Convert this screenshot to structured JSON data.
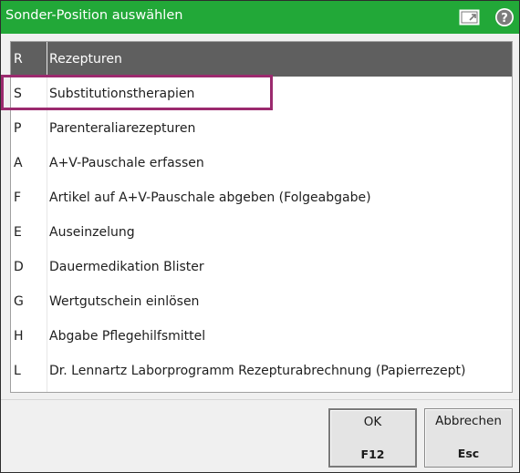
{
  "window": {
    "title": "Sonder-Position auswählen",
    "accent_color": "#22a838",
    "icons": [
      "window-switch-icon",
      "help-icon"
    ]
  },
  "list": {
    "header": {
      "key": "R",
      "label": "Rezepturen"
    },
    "items": [
      {
        "key": "S",
        "label": "Substitutionstherapien",
        "highlighted": true
      },
      {
        "key": "P",
        "label": "Parenteraliarezepturen"
      },
      {
        "key": "A",
        "label": "A+V-Pauschale erfassen"
      },
      {
        "key": "F",
        "label": "Artikel auf A+V-Pauschale abgeben (Folgeabgabe)"
      },
      {
        "key": "E",
        "label": "Auseinzelung"
      },
      {
        "key": "D",
        "label": "Dauermedikation Blister"
      },
      {
        "key": "G",
        "label": "Wertgutschein einlösen"
      },
      {
        "key": "H",
        "label": "Abgabe Pflegehilfsmittel"
      },
      {
        "key": "L",
        "label": "Dr. Lennartz Laborprogramm Rezepturabrechnung (Papierrezept)"
      }
    ],
    "highlight_color": "#9b2a6e"
  },
  "buttons": {
    "ok": {
      "label": "OK",
      "key": "F12"
    },
    "cancel": {
      "label": "Abbrechen",
      "key": "Esc"
    }
  }
}
